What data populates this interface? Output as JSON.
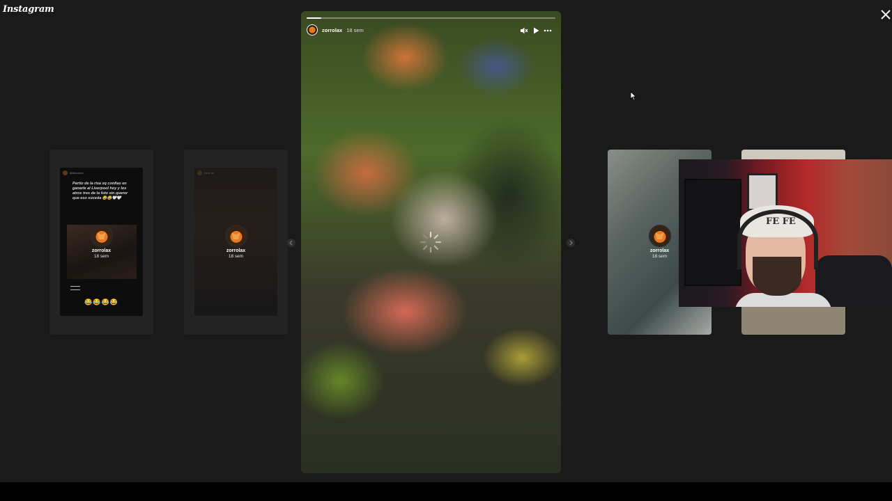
{
  "app": {
    "title": "Instagram"
  },
  "previews_left": [
    {
      "username": "didiieeeerrr",
      "caption": "Partio de la risa xq confias en ganarle al Liverpool hoy y los atros tres de la foto sin querer que eso suceda 😂😂🤍🤍",
      "emoji_line": "😂😂😂😂",
      "overlay_name": "zorrolax",
      "overlay_time": "18 sem"
    },
    {
      "username": "dave.ttn",
      "overlay_name": "zorrolax",
      "overlay_time": "18 sem"
    }
  ],
  "story": {
    "username": "zorrolax",
    "time": "18 sem",
    "progress": 0.06,
    "controls": [
      "mute-icon",
      "play-icon",
      "more-options-icon"
    ]
  },
  "previews_right": [
    {
      "overlay_name": "zorrolax",
      "overlay_time": "18 sem"
    }
  ],
  "webcam": {
    "cap_text": "FE FE"
  },
  "colors": {
    "background": "#1a1a1a",
    "accent": "#e77a24"
  }
}
